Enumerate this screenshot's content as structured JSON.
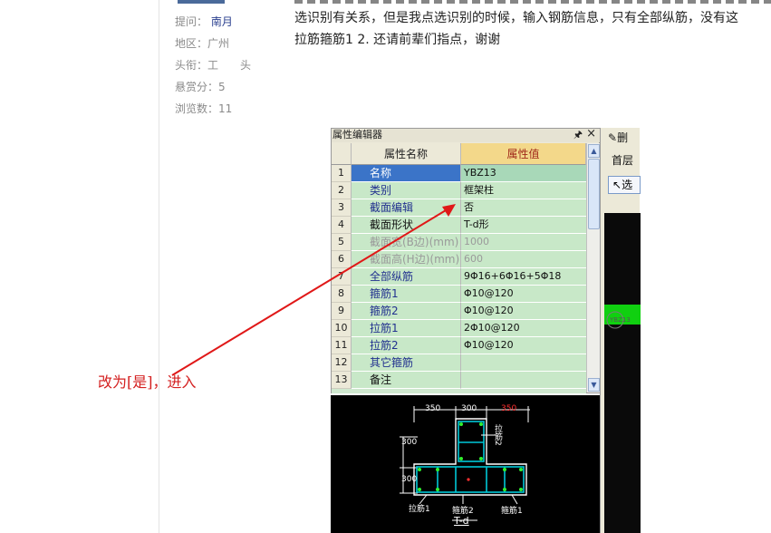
{
  "sidebar": {
    "asker_label": "提问：",
    "asker_name": "南月",
    "region_label": "地区：",
    "region_value": "广州",
    "title_label": "头衔：",
    "title_value": "工　　头",
    "bounty_label": "悬赏分：",
    "bounty_value": "5",
    "views_label": "浏览数：",
    "views_value": "11"
  },
  "post": {
    "line1": "选识别有关系，但是我点选识别的时候，输入钢筋信息，只有全部纵筋，没有这",
    "line2": "拉筋箍筋1 2. 还请前辈们指点，谢谢"
  },
  "annotation": {
    "text": "改为[是]，进入",
    "color": "#d42020"
  },
  "property_editor": {
    "title": "属性编辑器",
    "pin_icon": "pin-icon",
    "close_icon": "close-icon",
    "col_name": "属性名称",
    "col_value": "属性值",
    "rows": [
      {
        "num": "1",
        "name": "名称",
        "value": "YBZ13"
      },
      {
        "num": "2",
        "name": "类别",
        "value": "框架柱"
      },
      {
        "num": "3",
        "name": "截面编辑",
        "value": "否"
      },
      {
        "num": "4",
        "name": "截面形状",
        "value": "T-d形"
      },
      {
        "num": "5",
        "name": "截面宽(B边)(mm)",
        "value": "1000"
      },
      {
        "num": "6",
        "name": "截面高(H边)(mm)",
        "value": "600"
      },
      {
        "num": "7",
        "name": "全部纵筋",
        "value": "9Φ16+6Φ16+5Φ18"
      },
      {
        "num": "8",
        "name": "箍筋1",
        "value": "Φ10@120"
      },
      {
        "num": "9",
        "name": "箍筋2",
        "value": "Φ10@120"
      },
      {
        "num": "10",
        "name": "拉筋1",
        "value": "2Φ10@120"
      },
      {
        "num": "11",
        "name": "拉筋2",
        "value": "Φ10@120"
      },
      {
        "num": "12",
        "name": "其它箍筋",
        "value": ""
      },
      {
        "num": "13",
        "name": "备注",
        "value": ""
      }
    ]
  },
  "toolbar": {
    "delete_label": "删",
    "floor_label": "首层",
    "select_label": "选"
  },
  "drawing": {
    "dim_350_left": "350",
    "dim_300_mid": "300",
    "dim_350_right": "350",
    "dim_300_top": "300",
    "dim_300_bot": "300",
    "tie_top": "拉筋2",
    "tie_left": "拉筋1",
    "stirrup_mid": "箍筋2",
    "stirrup_right": "箍筋1",
    "shape_title": "T-d",
    "circle_label": "YBZ13"
  }
}
